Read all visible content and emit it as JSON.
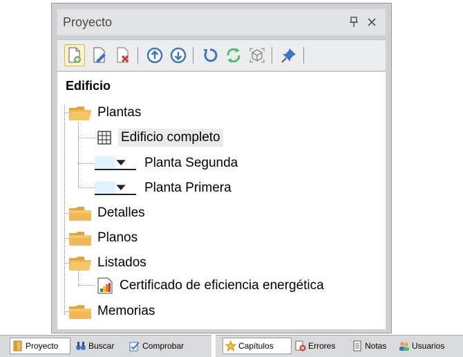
{
  "panel": {
    "title": "Proyecto",
    "pin_icon": "pin-icon",
    "close_icon": "close-icon"
  },
  "toolbar": {
    "buttons": [
      {
        "name": "new-document-button",
        "icon": "new-document-icon"
      },
      {
        "name": "edit-document-button",
        "icon": "edit-document-icon"
      },
      {
        "name": "delete-document-button",
        "icon": "delete-document-icon"
      },
      {
        "name": "move-up-button",
        "icon": "arrow-up-circle-icon"
      },
      {
        "name": "move-down-button",
        "icon": "arrow-down-circle-icon"
      },
      {
        "name": "undo-button",
        "icon": "undo-icon"
      },
      {
        "name": "refresh-button",
        "icon": "refresh-icon"
      },
      {
        "name": "view-3d-button",
        "icon": "cube-icon"
      },
      {
        "name": "pin-button",
        "icon": "pushpin-icon"
      }
    ]
  },
  "tree": {
    "root": "Edificio",
    "nodes": {
      "plantas": "Plantas",
      "edificio_completo": "Edificio completo",
      "planta_segunda": "Planta Segunda",
      "planta_primera": "Planta Primera",
      "detalles": "Detalles",
      "planos": "Planos",
      "listados": "Listados",
      "certificado": "Certificado de eficiencia energética",
      "memorias": "Memorias"
    },
    "selected": "Edificio completo"
  },
  "tabs_left": [
    {
      "label": "Proyecto",
      "icon": "book-icon",
      "active": true
    },
    {
      "label": "Buscar",
      "icon": "binoculars-icon",
      "active": false
    },
    {
      "label": "Comprobar",
      "icon": "check-tool-icon",
      "active": false
    }
  ],
  "tabs_right": [
    {
      "label": "Capítulos",
      "icon": "star-icon",
      "active": true
    },
    {
      "label": "Errores",
      "icon": "error-icon",
      "active": false
    },
    {
      "label": "Notas",
      "icon": "note-icon",
      "active": false
    },
    {
      "label": "Usuarios",
      "icon": "users-icon",
      "active": false
    }
  ],
  "colors": {
    "folder": "#f0b955",
    "accent_blue": "#3d74c8",
    "refresh_green": "#4dbb73"
  }
}
